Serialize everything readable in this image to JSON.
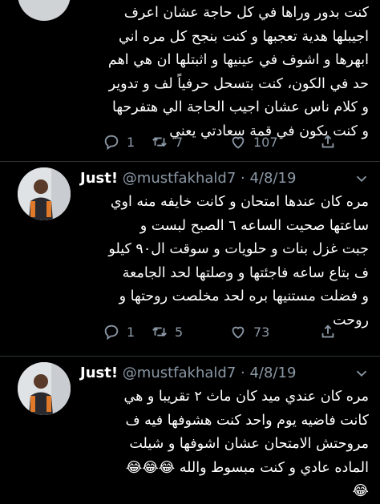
{
  "tweets": [
    {
      "body_lines": [
        "كنت بدور وراها في كل حاجة عشان اعرف",
        "اجيبلها هدية تعجبها و كنت بنجح كل مره اني",
        "ابهرها و اشوف في عينيها و اثبتلها ان هي اهم",
        "حد في الكون، كنت بتسحل حرفياً لف و تدوير",
        "و كلام ناس عشان اجيب الحاجة الي هتفرحها",
        "و كنت بكون في قمة سعادتي يعني"
      ],
      "replies": "1",
      "retweets": "7",
      "likes": "107"
    },
    {
      "name": "Just!",
      "handle": "@mustfakhald7",
      "date": "· 4/8/19",
      "body_lines": [
        "مره كان عندها امتحان و كانت خايفه منه اوي",
        "ساعتها صحيت الساعه ٦ الصبح لبست و",
        "جبت غزل بنات و حلويات و سوقت ال٩٠ كيلو",
        "ف بتاع ساعه فاجئتها و وصلتها لحد الجامعة",
        "و فضلت مستنيها بره لحد مخلصت روحتها و",
        "روحت"
      ],
      "replies": "1",
      "retweets": "5",
      "likes": "73"
    },
    {
      "name": "Just!",
      "handle": "@mustfakhald7",
      "date": "· 4/8/19",
      "body_lines": [
        "مره كان عندي ميد كان ماث ٢ تقريبا و هي",
        "كانت فاضيه يوم واحد كنت هشوفها فيه ف",
        "مروحتش الامتحان عشان اشوفها و شيلت",
        "الماده عادي و كنت مبسوط والله 😂😂😂",
        "😂"
      ]
    }
  ],
  "icons": {
    "reply": "reply-icon",
    "retweet": "retweet-icon",
    "like": "heart-icon",
    "share": "share-icon",
    "more": "chevron-down-icon"
  },
  "colors": {
    "background": "#000000",
    "text": "#ffffff",
    "secondary": "#8b98a5",
    "divider": "#2f3336"
  }
}
